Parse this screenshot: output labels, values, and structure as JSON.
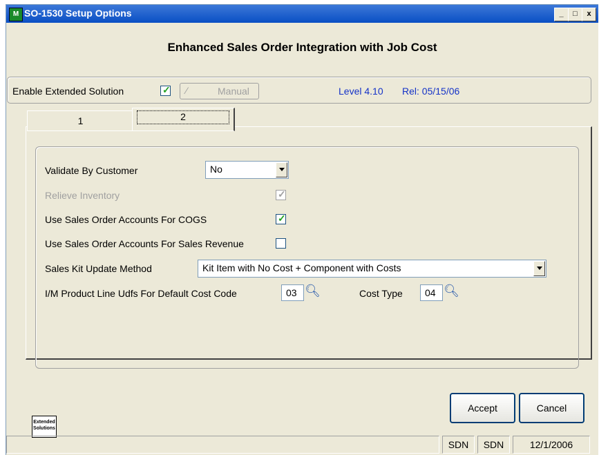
{
  "window": {
    "title": "SO-1530 Setup Options",
    "icon_label": "M",
    "minimize_icon": "_",
    "maximize_icon": "□",
    "close_icon": "x"
  },
  "heading": "Enhanced Sales Order Integration with Job Cost",
  "top_group": {
    "enable_label": "Enable Extended Solution",
    "enable_checked": true,
    "manual_label": "Manual",
    "manual_icon": "wand-icon",
    "level": "Level 4.10",
    "release": "Rel: 05/15/06"
  },
  "tabs": [
    {
      "label": "1"
    },
    {
      "label": "2"
    }
  ],
  "form": {
    "validate_label": "Validate By Customer",
    "validate_value": "No",
    "relieve_label": "Relieve Inventory",
    "relieve_checked": true,
    "cogs_label": "Use Sales Order Accounts For COGS",
    "cogs_checked": true,
    "revenue_label": "Use Sales Order Accounts For Sales Revenue",
    "revenue_checked": false,
    "kit_label": "Sales Kit Update Method",
    "kit_value": "Kit Item with No Cost + Component with Costs",
    "udf_label": "I/M Product Line Udfs For Default Cost Code",
    "udf_value": "03",
    "cost_type_label": "Cost Type",
    "cost_type_value": "04"
  },
  "buttons": {
    "accept_label": "Accept",
    "cancel_label": "Cancel"
  },
  "logo": {
    "line1": "Extended",
    "line2": "Solutions"
  },
  "statusbar": {
    "cell1": "SDN",
    "cell2": "SDN",
    "date": "12/1/2006"
  },
  "colors": {
    "titlebar": "#0a4fc4",
    "window_bg": "#ece9d8",
    "check_mark": "#21a121",
    "info_text": "#1432c8"
  }
}
